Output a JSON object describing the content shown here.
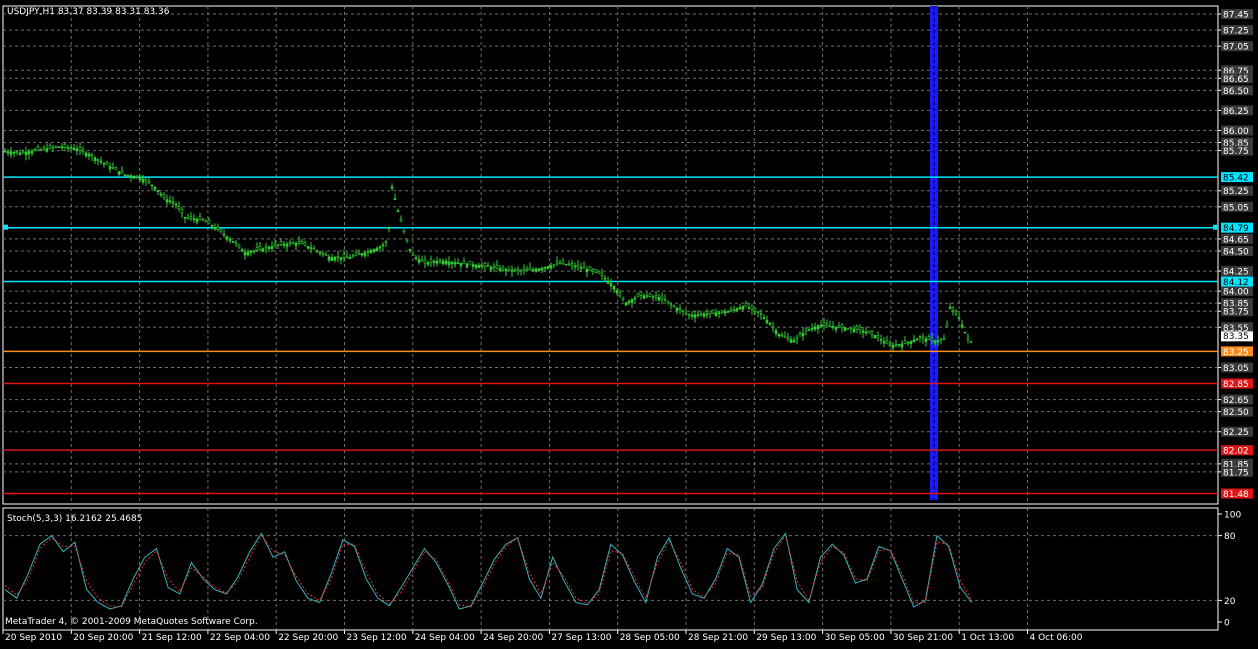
{
  "chart_data": [
    {
      "type": "candlestick",
      "title": "USDJPY,H1  83.37 83.39 83.31 83.36",
      "ylim": [
        81.35,
        87.55
      ],
      "grid": true,
      "y_ticks": [
        "87.45",
        "87.25",
        "87.05",
        "86.75",
        "86.65",
        "86.50",
        "86.25",
        "86.00",
        "85.85",
        "85.75",
        "85.25",
        "85.05",
        "84.65",
        "84.50",
        "84.25",
        "84.00",
        "83.85",
        "83.75",
        "83.55",
        "83.05",
        "82.65",
        "82.50",
        "82.25",
        "81.85",
        "81.75"
      ],
      "x_ticks": [
        "20 Sep 2010",
        "20 Sep 20:00",
        "21 Sep 12:00",
        "22 Sep 04:00",
        "22 Sep 20:00",
        "23 Sep 12:00",
        "24 Sep 04:00",
        "24 Sep 20:00",
        "27 Sep 13:00",
        "28 Sep 05:00",
        "28 Sep 21:00",
        "29 Sep 13:00",
        "30 Sep 05:00",
        "30 Sep 21:00",
        "1 Oct 13:00",
        "4 Oct 06:00"
      ],
      "price_path": [
        [
          0,
          85.75
        ],
        [
          20,
          85.72
        ],
        [
          40,
          85.76
        ],
        [
          60,
          85.8
        ],
        [
          75,
          85.78
        ],
        [
          90,
          85.7
        ],
        [
          110,
          85.55
        ],
        [
          125,
          85.45
        ],
        [
          140,
          85.42
        ],
        [
          155,
          85.3
        ],
        [
          165,
          85.15
        ],
        [
          175,
          85.1
        ],
        [
          185,
          84.92
        ],
        [
          205,
          84.88
        ],
        [
          220,
          84.75
        ],
        [
          235,
          84.6
        ],
        [
          245,
          84.48
        ],
        [
          260,
          84.52
        ],
        [
          280,
          84.58
        ],
        [
          300,
          84.6
        ],
        [
          315,
          84.52
        ],
        [
          330,
          84.42
        ],
        [
          350,
          84.42
        ],
        [
          365,
          84.48
        ],
        [
          380,
          84.55
        ],
        [
          388,
          84.62
        ],
        [
          392,
          85.3
        ],
        [
          398,
          85.0
        ],
        [
          405,
          84.7
        ],
        [
          412,
          84.45
        ],
        [
          425,
          84.35
        ],
        [
          440,
          84.38
        ],
        [
          460,
          84.35
        ],
        [
          480,
          84.32
        ],
        [
          500,
          84.28
        ],
        [
          520,
          84.25
        ],
        [
          540,
          84.28
        ],
        [
          560,
          84.35
        ],
        [
          580,
          84.3
        ],
        [
          600,
          84.22
        ],
        [
          615,
          84.05
        ],
        [
          625,
          83.85
        ],
        [
          640,
          83.95
        ],
        [
          660,
          83.92
        ],
        [
          675,
          83.8
        ],
        [
          690,
          83.7
        ],
        [
          710,
          83.72
        ],
        [
          730,
          83.75
        ],
        [
          745,
          83.82
        ],
        [
          760,
          83.72
        ],
        [
          770,
          83.6
        ],
        [
          780,
          83.45
        ],
        [
          795,
          83.38
        ],
        [
          805,
          83.5
        ],
        [
          820,
          83.58
        ],
        [
          840,
          83.55
        ],
        [
          860,
          83.52
        ],
        [
          875,
          83.45
        ],
        [
          890,
          83.32
        ],
        [
          905,
          83.35
        ],
        [
          920,
          83.42
        ],
        [
          935,
          83.38
        ],
        [
          945,
          83.4
        ],
        [
          950,
          83.8
        ],
        [
          958,
          83.7
        ],
        [
          963,
          83.55
        ],
        [
          968,
          83.4
        ],
        [
          972,
          83.36
        ]
      ],
      "series": [
        {
          "name": "",
          "value": 85.42,
          "color": "#00e5ff"
        },
        {
          "name": "",
          "value": 84.79,
          "color": "#00e5ff"
        },
        {
          "name": "",
          "value": 84.12,
          "color": "#00e5ff"
        },
        {
          "name": "",
          "value": 83.25,
          "color": "#ff8c1a"
        },
        {
          "name": "",
          "value": 82.85,
          "color": "#e01414"
        },
        {
          "name": "",
          "value": 82.02,
          "color": "#e01414"
        },
        {
          "name": "",
          "value": 81.48,
          "color": "#e01414"
        }
      ],
      "levels": [
        "85.42",
        "84.79",
        "84.12",
        "83.25",
        "82.85",
        "82.02",
        "81.48"
      ],
      "current_price": "83.35",
      "highlight_band_x": 934
    },
    {
      "type": "line",
      "title": "Stoch(5,3,3) 16.2162 25.4685",
      "ylim": [
        0,
        100
      ],
      "y_ticks": [
        "100",
        "80",
        "20",
        "0"
      ],
      "series": [
        {
          "name": "",
          "color": "#3ab0c0",
          "values": [
            30,
            22,
            45,
            72,
            80,
            65,
            74,
            30,
            18,
            12,
            15,
            40,
            60,
            68,
            32,
            26,
            55,
            40,
            30,
            26,
            42,
            65,
            82,
            60,
            65,
            38,
            22,
            18,
            45,
            76,
            70,
            40,
            22,
            15,
            32,
            50,
            68,
            55,
            35,
            12,
            15,
            36,
            58,
            72,
            78,
            40,
            22,
            60,
            38,
            18,
            16,
            30,
            72,
            62,
            38,
            18,
            60,
            78,
            50,
            26,
            22,
            40,
            68,
            60,
            18,
            35,
            68,
            82,
            30,
            18,
            60,
            72,
            62,
            36,
            40,
            70,
            66,
            40,
            14,
            20,
            80,
            70,
            32,
            18
          ]
        },
        {
          "name": "",
          "color": "#e03030",
          "values": [
            34,
            25,
            40,
            68,
            78,
            70,
            70,
            38,
            22,
            15,
            14,
            35,
            55,
            66,
            40,
            28,
            50,
            42,
            32,
            27,
            38,
            60,
            80,
            66,
            62,
            42,
            26,
            20,
            40,
            72,
            72,
            46,
            26,
            17,
            28,
            46,
            65,
            58,
            38,
            16,
            14,
            32,
            54,
            70,
            78,
            46,
            26,
            55,
            42,
            22,
            17,
            26,
            66,
            64,
            42,
            22,
            55,
            75,
            55,
            30,
            23,
            36,
            64,
            62,
            24,
            32,
            64,
            80,
            38,
            20,
            55,
            70,
            64,
            40,
            38,
            66,
            67,
            44,
            18,
            18,
            74,
            72,
            38,
            20
          ]
        }
      ]
    }
  ],
  "footer": {
    "copyright": "MetaTrader 4, © 2001-2009 MetaQuotes Software Corp."
  },
  "colors": {
    "candle": "#33cc33",
    "grid": "#6f6f6f",
    "frame": "#ffffff",
    "band": "#1a1aff"
  }
}
